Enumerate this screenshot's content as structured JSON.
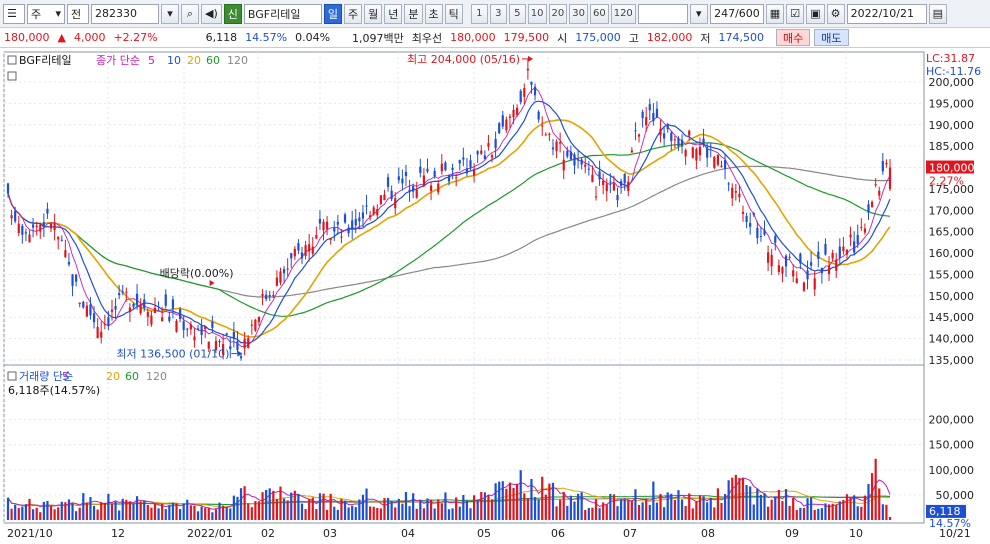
{
  "toolbar": {
    "market": "주",
    "period_type": "전",
    "stock_code": "282330",
    "credit_badge": "신",
    "stock_name": "BGF리테일",
    "periods": [
      "일",
      "주",
      "월",
      "년",
      "분",
      "초",
      "틱"
    ],
    "intervals": [
      "1",
      "3",
      "5",
      "10",
      "20",
      "30",
      "60",
      "120"
    ],
    "bar_count": "247/600",
    "date": "2022/10/21"
  },
  "quote": {
    "price": "180,000",
    "change": "4,000",
    "change_rate": "+2.27%",
    "volume": "6,118",
    "volume_rate": "14.57%",
    "turnover_rate": "0.04%",
    "trade_value": "1,097백만",
    "best_label": "최우선",
    "best_ask": "180,000",
    "best_bid": "179,500",
    "open_label": "시",
    "open": "175,000",
    "high_label": "고",
    "high": "182,000",
    "low_label": "저",
    "low": "174,500",
    "buy_label": "매수",
    "sell_label": "매도"
  },
  "chart_data": {
    "type": "candlestick",
    "lc": "LC:31.87",
    "hc": "HC:-11.76",
    "legend": {
      "stock": "BGF리테일",
      "price_label": "종가 단순",
      "ma": [
        "5",
        "10",
        "20",
        "60",
        "120"
      ]
    },
    "volume_legend": {
      "title": "거래량 단순",
      "ma": [
        "5",
        "20",
        "60",
        "120"
      ],
      "value": "6,118주(14.57%)"
    },
    "colors": {
      "up": "#e0161f",
      "down": "#1d4fd6",
      "ma5": "#c21fb8",
      "ma10": "#1d4fd6",
      "ma20": "#e3a400",
      "ma60": "#1a9a2a",
      "ma120": "#888888"
    },
    "price_axis": {
      "min": 135000,
      "max": 200000,
      "ticks": [
        "200,000",
        "195,000",
        "190,000",
        "185,000",
        "180,000",
        "175,000",
        "170,000",
        "165,000",
        "160,000",
        "155,000",
        "150,000",
        "145,000",
        "140,000",
        "135,000"
      ]
    },
    "volume_axis": {
      "max": 200000,
      "ticks": [
        "200,000",
        "150,000",
        "100,000",
        "50,000"
      ]
    },
    "x_labels": [
      "2021/10",
      "12",
      "2022/01",
      "02",
      "03",
      "04",
      "05",
      "06",
      "07",
      "08",
      "09",
      "10",
      "10/21"
    ],
    "current_price_label": "180,000",
    "current_change_label": "2.27%",
    "current_volume_label": "6,118",
    "current_volume_rate_label": "14.57%",
    "annotations": {
      "high": "최고 204,000 (05/16)",
      "low": "최저 136,500 (01/10)",
      "dividend": "배당락(0.00%)"
    },
    "anchors": [
      [
        "2021/10/01",
        172000,
        35000
      ],
      [
        "2021/10/08",
        166000,
        32000
      ],
      [
        "2021/10/20",
        168000,
        28000
      ],
      [
        "2021/11/01",
        150000,
        40000
      ],
      [
        "2021/11/10",
        143000,
        45000
      ],
      [
        "2021/11/22",
        150000,
        38000
      ],
      [
        "2021/12/06",
        147000,
        30000
      ],
      [
        "2021/12/20",
        143000,
        32000
      ],
      [
        "2022/01/03",
        139000,
        35000
      ],
      [
        "2022/01/10",
        137000,
        50000
      ],
      [
        "2022/01/20",
        149000,
        55000
      ],
      [
        "2022/02/03",
        159000,
        48000
      ],
      [
        "2022/02/15",
        165000,
        40000
      ],
      [
        "2022/02/25",
        165000,
        38000
      ],
      [
        "2022/03/08",
        171000,
        50000
      ],
      [
        "2022/03/21",
        176000,
        42000
      ],
      [
        "2022/04/04",
        178000,
        45000
      ],
      [
        "2022/04/18",
        180000,
        40000
      ],
      [
        "2022/05/02",
        185000,
        55000
      ],
      [
        "2022/05/16",
        201000,
        85000
      ],
      [
        "2022/05/24",
        188000,
        60000
      ],
      [
        "2022/06/03",
        183000,
        45000
      ],
      [
        "2022/06/15",
        175000,
        40000
      ],
      [
        "2022/06/27",
        174000,
        38000
      ],
      [
        "2022/07/05",
        194000,
        65000
      ],
      [
        "2022/07/15",
        188000,
        50000
      ],
      [
        "2022/07/27",
        186000,
        40000
      ],
      [
        "2022/08/05",
        183000,
        55000
      ],
      [
        "2022/08/16",
        173000,
        70000
      ],
      [
        "2022/08/26",
        163000,
        55000
      ],
      [
        "2022/09/07",
        157000,
        45000
      ],
      [
        "2022/09/16",
        155000,
        40000
      ],
      [
        "2022/09/28",
        160000,
        38000
      ],
      [
        "2022/10/07",
        163000,
        40000
      ],
      [
        "2022/10/14",
        175000,
        120000
      ],
      [
        "2022/10/21",
        180000,
        6118
      ]
    ]
  }
}
